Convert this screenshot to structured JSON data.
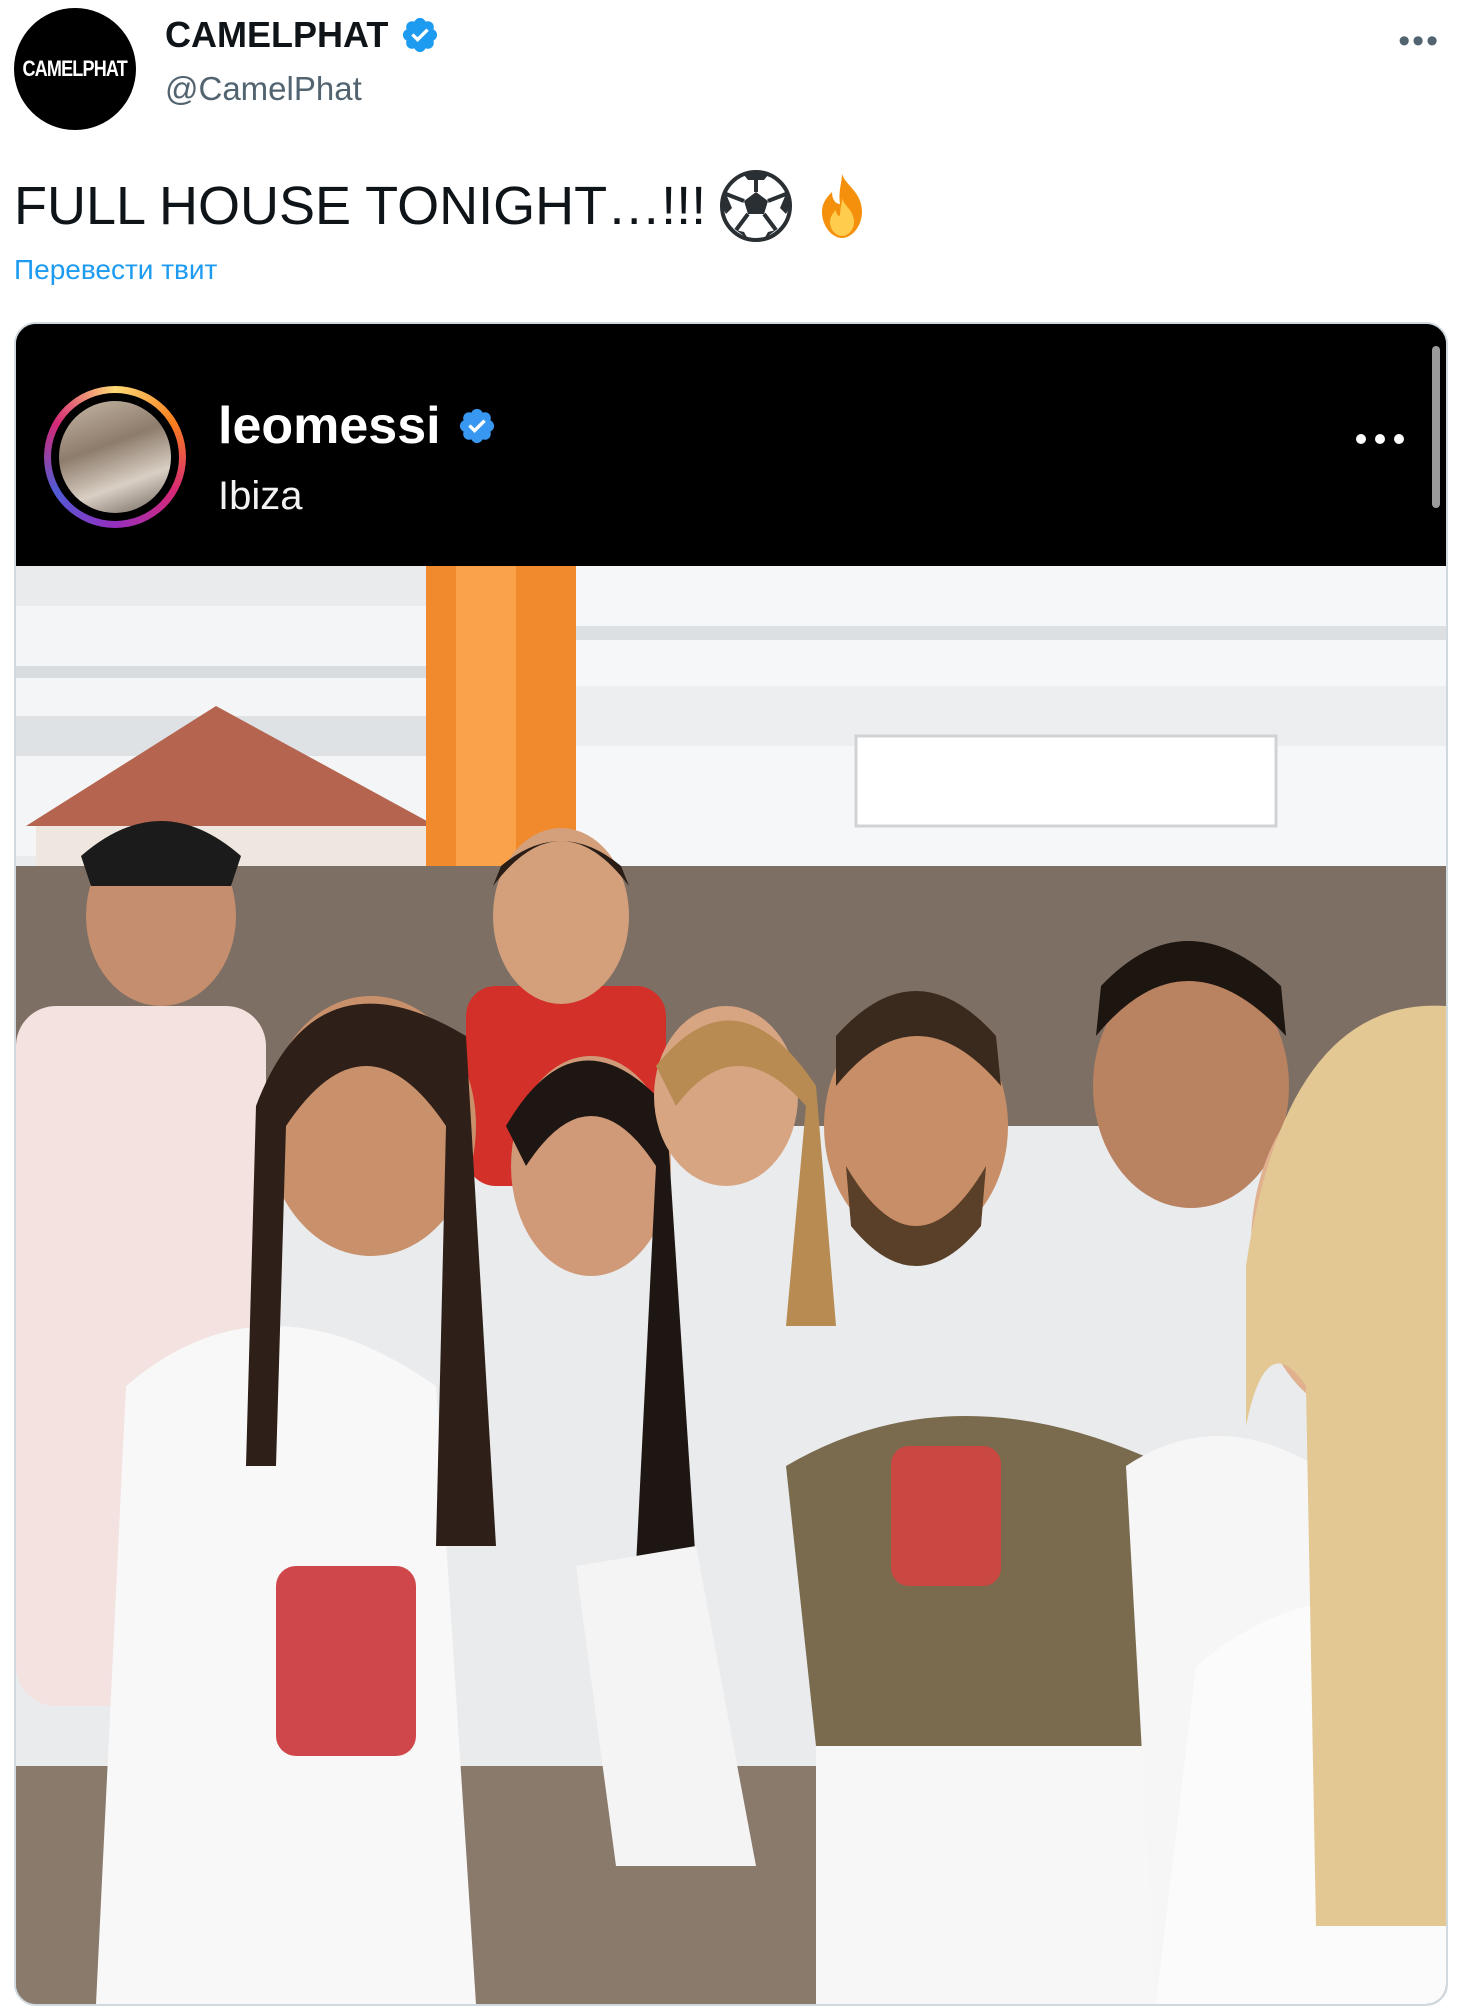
{
  "tweet": {
    "author": {
      "avatar_text": "CAMELPHAT",
      "display_name": "CAMELPHAT",
      "handle": "@CamelPhat",
      "verified": true
    },
    "text": "FULL HOUSE TONIGHT…!!!",
    "emojis": [
      "soccer-ball-icon",
      "fire-icon"
    ],
    "translate_link": "Перевести твит",
    "more_label": "•••"
  },
  "embed": {
    "username": "leomessi",
    "verified": true,
    "location": "Ibiza"
  },
  "photo": {
    "description": "group selfie on hotel terrace"
  },
  "colors": {
    "link": "#1d9bf0",
    "verified_badge": "#1d9bf0",
    "secondary_text": "#536471",
    "card_border": "#cfd9de"
  }
}
